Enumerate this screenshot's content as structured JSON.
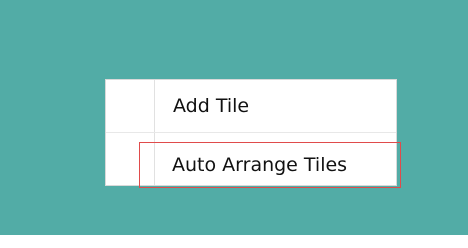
{
  "context_menu": {
    "items": [
      {
        "label": "Add Tile"
      },
      {
        "label": "Auto Arrange Tiles"
      }
    ]
  },
  "colors": {
    "desktop_background": "#52aca6",
    "menu_background": "#ffffff",
    "highlight_border": "#e04b4b"
  }
}
